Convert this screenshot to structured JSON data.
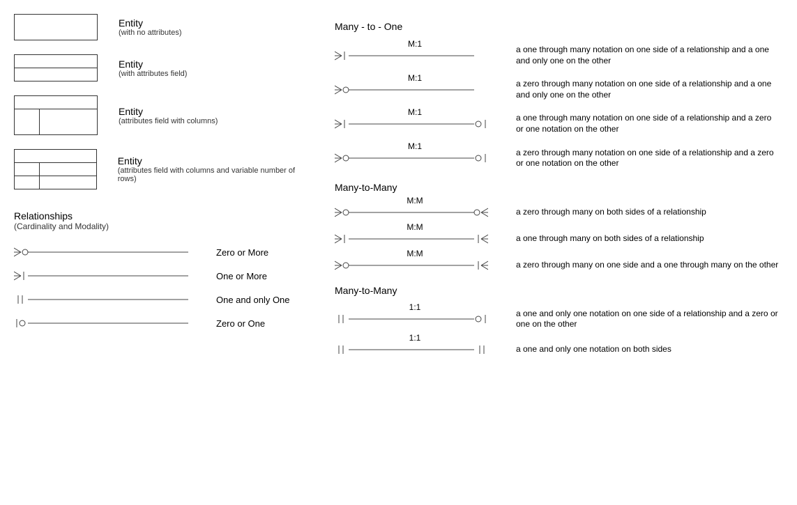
{
  "entities": [
    {
      "title": "Entity",
      "sub": "(with no attributes)"
    },
    {
      "title": "Entity",
      "sub": "(with attributes field)"
    },
    {
      "title": "Entity",
      "sub": "(attributes field with columns)"
    },
    {
      "title": "Entity",
      "sub": "(attributes field with columns and variable number of rows)"
    }
  ],
  "relationships_heading": {
    "title": "Relationships",
    "sub": "(Cardinality and Modality)"
  },
  "basic_relationships": [
    {
      "label": "Zero or More",
      "end": "zero_or_more"
    },
    {
      "label": "One or More",
      "end": "one_or_more"
    },
    {
      "label": "One and only One",
      "end": "one_only"
    },
    {
      "label": "Zero or One",
      "end": "zero_or_one"
    }
  ],
  "sections": [
    {
      "title": "Many - to - One",
      "rows": [
        {
          "left": "one_or_more",
          "right": "one_only",
          "ratio": "M:1",
          "desc": "a one through many notation on one side of a relationship and a one and only one on the other"
        },
        {
          "left": "zero_or_more",
          "right": "one_only",
          "ratio": "M:1",
          "desc": "a zero through many notation on one side of a relationship and a one and only one on the other"
        },
        {
          "left": "one_or_more",
          "right": "zero_or_one_r",
          "ratio": "M:1",
          "desc": "a one through many notation on one side of a relationship and a zero or one notation on the other"
        },
        {
          "left": "zero_or_more",
          "right": "zero_or_one_r",
          "ratio": "M:1",
          "desc": "a zero through many notation on one side of a relationship and a zero or one notation on the other"
        }
      ]
    },
    {
      "title": "Many-to-Many",
      "rows": [
        {
          "left": "zero_or_more",
          "right": "zero_or_more_r",
          "ratio": "M:M",
          "desc": "a zero through many on both sides of a relationship"
        },
        {
          "left": "one_or_more",
          "right": "one_or_more_r",
          "ratio": "M:M",
          "desc": "a one through many on both sides of a relationship"
        },
        {
          "left": "zero_or_more",
          "right": "one_or_more_r",
          "ratio": "M:M",
          "desc": "a zero through many on one side and a one through many on the other"
        }
      ]
    },
    {
      "title": "Many-to-Many",
      "rows": [
        {
          "left": "one_only",
          "right": "zero_or_one_r",
          "ratio": "1:1",
          "desc": "a one and only one notation on one side of a relationship and a zero or one on the other"
        },
        {
          "left": "one_only",
          "right": "one_only_r",
          "ratio": "1:1",
          "desc": "a one and only one notation on both sides"
        }
      ]
    }
  ]
}
